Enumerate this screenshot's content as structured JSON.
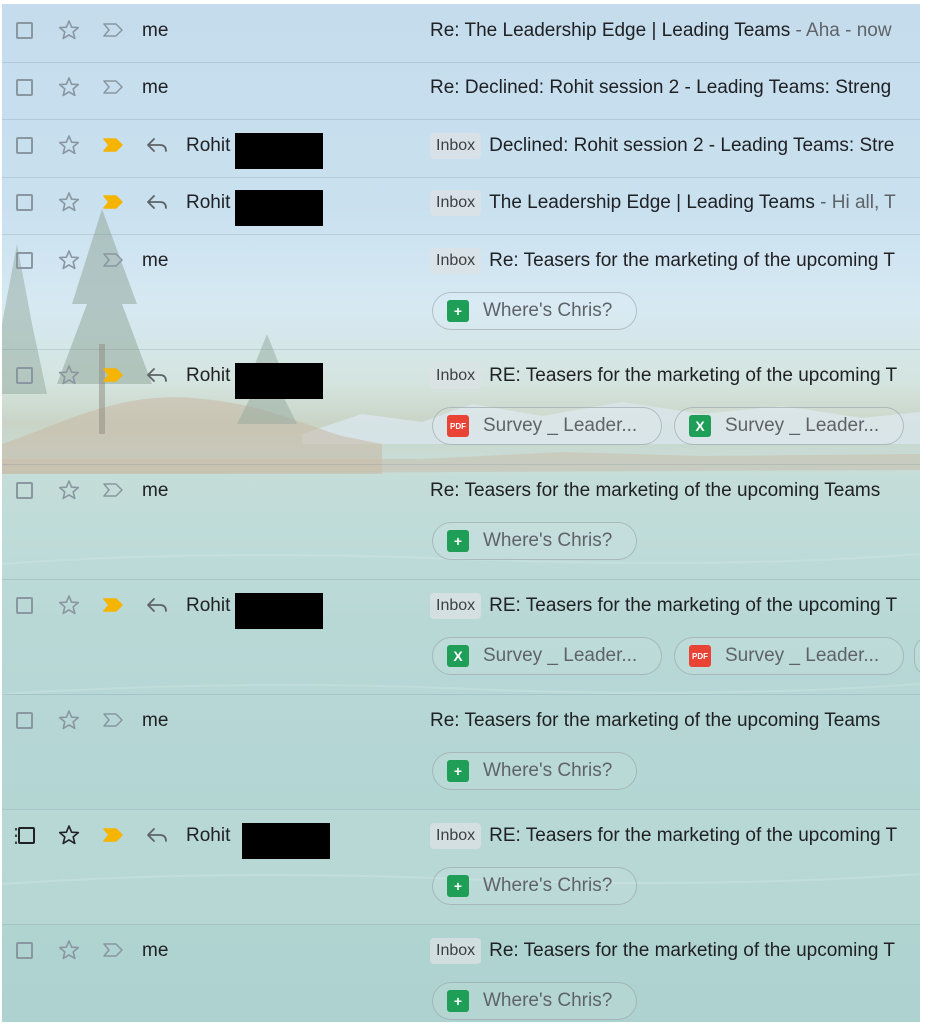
{
  "colors": {
    "important_active": "#f4b400",
    "important_inactive": "#8a96a0",
    "sheets_green": "#1e9e57",
    "pdf_red": "#e94335"
  },
  "emails": [
    {
      "sender": "me",
      "badge": "",
      "subject": "Re: The Leadership Edge | Leading Teams",
      "snippet": " - Aha - now",
      "important": false,
      "replied": false,
      "attachments": []
    },
    {
      "sender": "me",
      "badge": "",
      "subject": "Re: Declined: Rohit session 2 - Leading Teams: Streng",
      "snippet": "",
      "important": false,
      "replied": false,
      "attachments": []
    },
    {
      "sender": "Rohit",
      "badge": "Inbox",
      "subject": "Declined: Rohit session 2 - Leading Teams: Stre",
      "snippet": "",
      "important": true,
      "replied": true,
      "attachments": []
    },
    {
      "sender": "Rohit",
      "badge": "Inbox",
      "subject": "The Leadership Edge | Leading Teams",
      "snippet": " - Hi all, T",
      "important": true,
      "replied": true,
      "attachments": []
    },
    {
      "sender": "me",
      "badge": "Inbox",
      "subject": "Re: Teasers for the marketing of the upcoming T",
      "snippet": "",
      "important": false,
      "replied": false,
      "attachments": [
        {
          "type": "sheets",
          "icon": "sheets-icon",
          "name": "Where's Chris?"
        }
      ]
    },
    {
      "sender": "Rohit",
      "badge": "Inbox",
      "subject": "RE: Teasers for the marketing of the upcoming T",
      "snippet": "",
      "important": true,
      "replied": true,
      "attachments": [
        {
          "type": "pdf",
          "icon": "pdf-icon",
          "name": "Survey _ Leader..."
        },
        {
          "type": "excel",
          "icon": "excel-icon",
          "name": "Survey _ Leader..."
        }
      ]
    },
    {
      "sender": "me",
      "badge": "",
      "subject": "Re: Teasers for the marketing of the upcoming Teams",
      "snippet": "",
      "important": false,
      "replied": false,
      "attachments": [
        {
          "type": "sheets",
          "icon": "sheets-icon",
          "name": "Where's Chris?"
        }
      ]
    },
    {
      "sender": "Rohit",
      "badge": "Inbox",
      "subject": "RE: Teasers for the marketing of the upcoming T",
      "snippet": "",
      "important": true,
      "replied": true,
      "attachments": [
        {
          "type": "excel",
          "icon": "excel-icon",
          "name": "Survey _ Leader..."
        },
        {
          "type": "pdf",
          "icon": "pdf-icon",
          "name": "Survey _ Leader..."
        }
      ]
    },
    {
      "sender": "me",
      "badge": "",
      "subject": "Re: Teasers for the marketing of the upcoming Teams",
      "snippet": "",
      "important": false,
      "replied": false,
      "attachments": [
        {
          "type": "sheets",
          "icon": "sheets-icon",
          "name": "Where's Chris?"
        }
      ]
    },
    {
      "sender": "Rohit",
      "badge": "Inbox",
      "subject": "RE: Teasers for the marketing of the upcoming T",
      "snippet": "",
      "important": true,
      "replied": true,
      "attachments": [
        {
          "type": "sheets",
          "icon": "sheets-icon",
          "name": "Where's Chris?"
        }
      ]
    },
    {
      "sender": "me",
      "badge": "Inbox",
      "subject": "Re: Teasers for the marketing of the upcoming T",
      "snippet": "",
      "important": false,
      "replied": false,
      "attachments": [
        {
          "type": "sheets",
          "icon": "sheets-icon",
          "name": "Where's Chris?"
        }
      ]
    }
  ],
  "icons": {
    "checkbox": "checkbox-icon",
    "star": "star-icon",
    "important": "important-marker-icon",
    "reply": "reply-icon",
    "drag": "drag-handle-icon"
  },
  "glyphs": {
    "sheets": "+",
    "excel": "X",
    "pdf": "PDF"
  }
}
